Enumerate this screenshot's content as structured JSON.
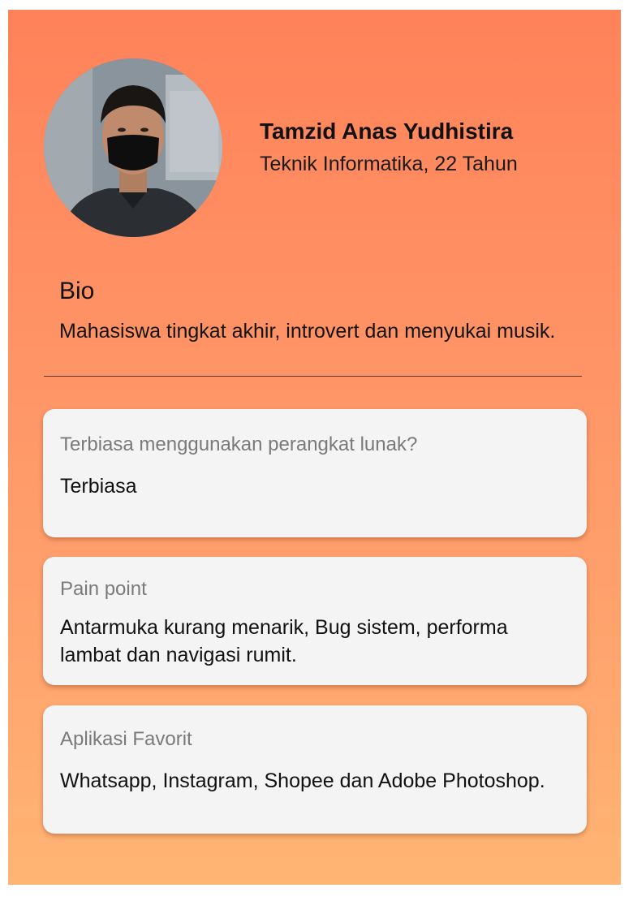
{
  "profile": {
    "name": "Tamzid Anas Yudhistira",
    "subtitle": "Teknik Informatika, 22 Tahun"
  },
  "bio": {
    "title": "Bio",
    "text": "Mahasiswa tingkat akhir, introvert dan menyukai musik."
  },
  "cards": [
    {
      "label": "Terbiasa menggunakan perangkat lunak?",
      "value": "Terbiasa"
    },
    {
      "label": "Pain point",
      "value": "Antarmuka kurang menarik, Bug sistem, performa lambat dan navigasi rumit."
    },
    {
      "label": "Aplikasi Favorit",
      "value": "Whatsapp, Instagram, Shopee dan Adobe Photoshop."
    }
  ],
  "colors": {
    "gradient_top": "#ff8259",
    "gradient_bottom": "#ffb574",
    "card_background": "#f4f4f4",
    "label_gray": "#7a7a7a"
  }
}
